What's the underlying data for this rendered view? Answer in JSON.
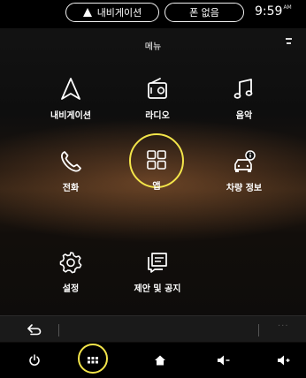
{
  "status_bar": {
    "nav_pill_label": "내비게이션",
    "phone_pill_label": "폰 없음",
    "time": "9:59",
    "ampm": "AM"
  },
  "header": {
    "title": "메뉴"
  },
  "menu_items": [
    {
      "label": "내비게이션",
      "icon": "navigation-arrow-icon"
    },
    {
      "label": "라디오",
      "icon": "radio-icon"
    },
    {
      "label": "음악",
      "icon": "music-note-icon"
    },
    {
      "label": "전화",
      "icon": "phone-icon"
    },
    {
      "label": "앱",
      "icon": "apps-grid-icon",
      "highlighted": true
    },
    {
      "label": "차량 정보",
      "icon": "vehicle-info-icon"
    },
    {
      "label": "설정",
      "icon": "gear-icon"
    },
    {
      "label": "제안 및 공지",
      "icon": "notice-icon"
    }
  ],
  "back_bar": {
    "more_label": "···"
  },
  "bottom_bar": {
    "buttons": [
      "power-icon",
      "apps-icon",
      "home-icon",
      "volume-down-icon",
      "volume-up-icon"
    ]
  },
  "colors": {
    "highlight": "#f3e54a",
    "background": "#0e0e0e"
  }
}
